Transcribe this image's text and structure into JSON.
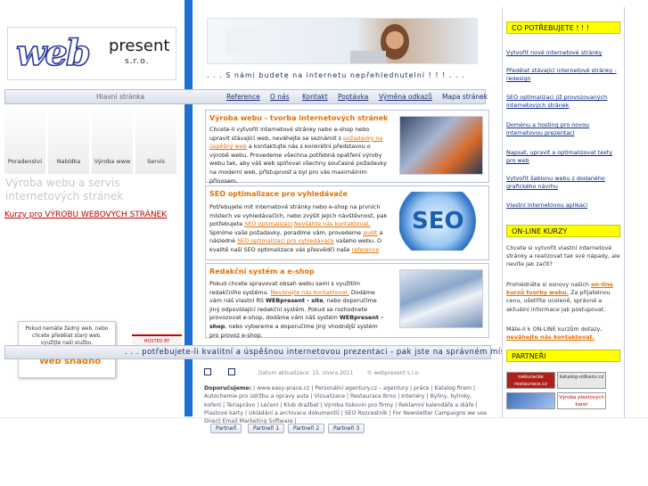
{
  "logo": {
    "main": "web",
    "sub": "present",
    "suffix": "s.r.o."
  },
  "tagline": ". . . S námi budete na internetu nepřehlednutelní ! ! ! . . .",
  "nav": {
    "home": "Hlavní stránka",
    "items": [
      "Reference",
      "O nás",
      "Kontakt",
      "Poptávka",
      "Výměna odkazů",
      "Mapa stránek"
    ]
  },
  "left": {
    "tiles": [
      "Poradenství",
      "Nabídka",
      "Výroba www",
      "Servis"
    ],
    "heading": "Výroba webu a servis internetových stránek",
    "course_link": "Kurzy pro VÝROBU WEBOVÝCH STRÁNEK",
    "popup_text": "Pokud nemáte žádný web. nebo chcete předělat starý web. využijte naši službu.",
    "popup_button": "Web snadno",
    "hosted_label": "HOSTED BY"
  },
  "cards": [
    {
      "title": "Výroba webu - tvorba internetových stránek",
      "text": "Chcete-li vytvořit internetové stránky nebo e-shop nebo upravit stávající web, neváhejte se seznámit s",
      "link": "požadavky na úspěšný web",
      "text2": "a kontaktujte nás s konkrétní představou o výrobě webu. Provedeme všechna potřebná opatření výroby webu tak, aby váš web splňoval všechny současné požadavky na moderní web, přístupnost a byl pro vás maximálním přínosem."
    },
    {
      "title": "SEO optimalizace pro vyhledávače",
      "text": "Potřebujete mít internetové stránky nebo e-shop na prvních místech ve vyhledávačích, nebo zvýšit jejich návštěvnost, pak potřebujete",
      "link": "SEO optimalizaci",
      "link2": "Nevšáhte nás kontaktovat.",
      "text2": "Splníme vaše požadavky, poradíme vám, provedeme",
      "link3": "audit",
      "text3": "a následné",
      "link4": "SEO optimalizaci pro vyhledávače",
      "text4": "vašeho webu. O kvalitě naší SEO optimalizace vás přesvědčí naše",
      "link5": "reference",
      "image_label": "SEO"
    },
    {
      "title": "Redakční systém a e-shop",
      "text": "Pokud chcete spravovat obsah webu sami s využitím redakčního systému.",
      "link": "Neváhejte nás kontaktovat.",
      "text2": "Dodáme vám náš vlastní RS",
      "bold1": "WEBpresent - site",
      "text3": ", nebo doporučíme jiný odpovídající redakční systém. Pokud se rozhodnete provozovat e-shop, dodáme vám náš systém",
      "bold2": "WEBpresent - shop",
      "text4": ", nebo vybereme a doporučíme jiný vhodnější systém pro provoz e-shop."
    }
  ],
  "bottom_strip": ". . . potřebujete-li kvalitní a úspěšnou internetovou prezentaci - pak jste na správném místě . . .",
  "footer": {
    "date": "Datum aktualizace: 15. února 2011",
    "copyright": "© webpresent s.r.o.",
    "recommend_label": "Doporučujeme:",
    "links": "| www.easy-prace.cz | Personální agentury.cz – agentury | práce | Katalog firem | Autochemie pro údržbu a opravy auta | Vizualizace | Restaurace Brno | Interiéry | Byliny, bylinky, koření | Teriaprávo | Léčení | Klub dražbat | Výroba tiskovin pro firmy | Reklamní kalendáře a diáře | Plastové karty | Ukládání a archivace dokumentů | SEO Rozcestník | For Newsletter Campaigns we use Direct Email Marketing Software |",
    "partner_buttons": [
      "Partneři",
      "Partneři 1",
      "Partneři 2",
      "Partneři 3"
    ]
  },
  "right": {
    "need_title": "CO POTŘEBUJETE ! ! !",
    "need_links": [
      "Vytvořit nové internetové stránky",
      "Předělat stávající internetové stránky - redesign",
      "SEO optimalizaci již provozovaných internetových stránek",
      "Doménu a hosting pro novou internetovou prezentaci",
      "Napsat, upravit a optimalizovat texty pro web",
      "Vytvořit šablonu webu z dodaného grafického návrhu",
      "Vlastní internetovou aplikaci"
    ],
    "courses_title": "ON-LINE KURZY",
    "courses_p1": "Chcete si vytvořit vlastní internetové stránky a realizovat tak své nápady, ale nevíte jak začít?",
    "courses_p2a": "Prohlédněte si osnovy našich",
    "courses_p2_link": "on-line kurzů tvorby webu.",
    "courses_p2b": "Za přijatelnou cenu, ušetříte uceleně, správné a aktuální informace jak postupovat.",
    "courses_p3a": "Máte-li k ON-LINE kurzům dotazy,",
    "courses_p3_link": "neváhejte nás kontaktovat.",
    "partners_title": "PARTNEŘI",
    "partners": [
      "nekuracke restaurace.cz",
      "katalog-odkazu.cz",
      "",
      "Výroba plastových karet"
    ]
  }
}
